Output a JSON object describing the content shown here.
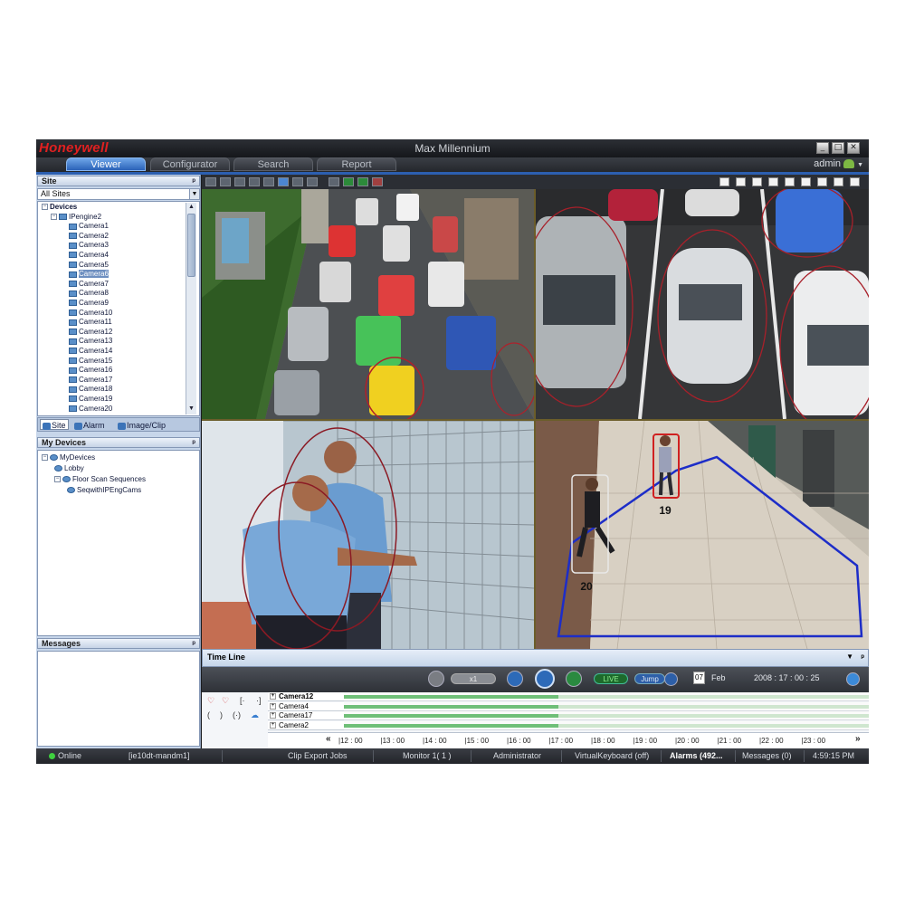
{
  "app": {
    "logo": "Honeywell",
    "title": "Max Millennium",
    "window_buttons": [
      "_",
      "□",
      "✕"
    ]
  },
  "tabs": [
    {
      "label": "Viewer",
      "active": true
    },
    {
      "label": "Configurator",
      "active": false
    },
    {
      "label": "Search",
      "active": false
    },
    {
      "label": "Report",
      "active": false
    }
  ],
  "user": {
    "name": "admin",
    "caret": "▼"
  },
  "site_panel": {
    "header": "Site",
    "pin": "ᵖ",
    "selected_site": "All Sites",
    "devices_label": "Devices",
    "engine": "IPengine2",
    "cameras": [
      "Camera1",
      "Camera2",
      "Camera3",
      "Camera4",
      "Camera5",
      "Camera6",
      "Camera7",
      "Camera8",
      "Camera9",
      "Camera10",
      "Camera11",
      "Camera12",
      "Camera13",
      "Camera14",
      "Camera15",
      "Camera16",
      "Camera17",
      "Camera18",
      "Camera19",
      "Camera20"
    ],
    "selected_camera": "Camera6",
    "bottom_tabs": [
      "Site",
      "Alarm",
      "Image/Clip"
    ]
  },
  "mydevices_panel": {
    "header": "My Devices",
    "items": [
      {
        "label": "MyDevices",
        "level": 0
      },
      {
        "label": "Lobby",
        "level": 1
      },
      {
        "label": "Floor Scan Sequences",
        "level": 1
      },
      {
        "label": "SeqwithIPEngCams",
        "level": 2
      }
    ]
  },
  "messages_panel": {
    "header": "Messages"
  },
  "video": {
    "person_labels": [
      "19",
      "20"
    ]
  },
  "timeline": {
    "header": "Time Line",
    "controls": {
      "live": "LIVE",
      "jump": "Jump",
      "speed": "x1",
      "day": "07",
      "month": "Feb",
      "datetime": "2008 : 17 : 00 : 25"
    },
    "cameras": [
      "Camera12",
      "Camera4",
      "Camera17",
      "Camera2"
    ],
    "ruler_prev": "«",
    "ruler_next": "»",
    "ticks": [
      "12 : 00",
      "13 : 00",
      "14 : 00",
      "15 : 00",
      "16 : 00",
      "17 : 00",
      "18 : 00",
      "19 : 00",
      "20 : 00",
      "21 : 00",
      "22 : 00",
      "23 : 00"
    ]
  },
  "status_bar": {
    "online": "Online",
    "host": "[ie10dt-mandm1]",
    "clip_jobs": "Clip Export Jobs",
    "monitor": "Monitor 1( 1 )",
    "role": "Administrator",
    "keyboard": "VirtualKeyboard (off)",
    "alarms": "Alarms (492...",
    "messages": "Messages (0)",
    "time": "4:59:15 PM"
  },
  "colors": {
    "logo_red": "#e02020",
    "tab_active": "#2a62b8",
    "panel_bg": "#c7d6ea",
    "online_green": "#3fd13f"
  }
}
